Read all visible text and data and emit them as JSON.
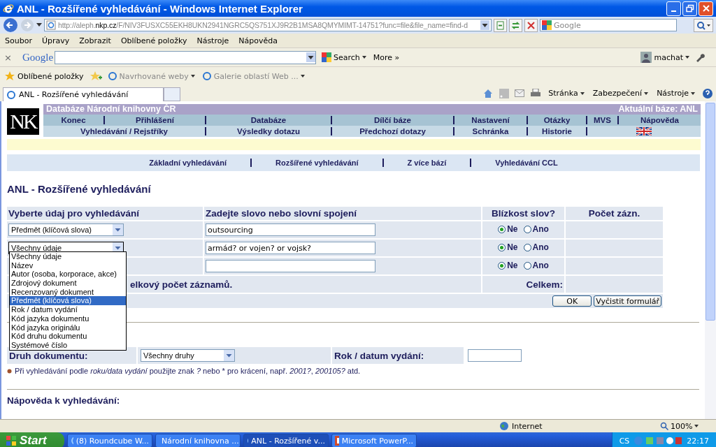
{
  "window": {
    "title": "ANL - Rozšířené vyhledávání - Windows Internet Explorer"
  },
  "address_bar": {
    "url_start": "http://aleph.",
    "url_domain": "nkp.cz",
    "url_end": "/F/NIV3FUSXC55EKH8UKN2941NGRC5QS751XJ9R2B1MSA8QMYMIMT-14751?func=file&file_name=find-d"
  },
  "search_box": {
    "placeholder": "Google"
  },
  "menu": [
    "Soubor",
    "Úpravy",
    "Zobrazit",
    "Oblíbené položky",
    "Nástroje",
    "Nápověda"
  ],
  "google_toolbar": {
    "close": "×",
    "logo": "Google",
    "search": "Search",
    "more": "More »",
    "user": "machat"
  },
  "favorites": {
    "label": "Oblíbené položky",
    "items": [
      "Navrhované weby",
      "Galerie oblastí Web ..."
    ]
  },
  "tabs": [
    {
      "label": "ANL - Rozšířené vyhledávání",
      "selected": true
    }
  ],
  "command_bar": [
    "Stránka",
    "Zabezpečení",
    "Nástroje"
  ],
  "page": {
    "logo": "NK",
    "site_title": "Databáze Národní knihovny ČR",
    "current_base": "Aktuální báze:  ANL",
    "nav_row_1": [
      "Konec",
      "Přihlášení",
      "Databáze",
      "Dílčí báze",
      "Nastavení",
      "Otázky",
      "MVS",
      "Nápověda"
    ],
    "nav_row_2": [
      "Vyhledávání / Rejstříky",
      "Výsledky dotazu",
      "Předchozí dotazy",
      "Schránka",
      "Historie"
    ],
    "subnav": [
      "Základní vyhledávání",
      "Rozšířené vyhledávání",
      "Z více bází",
      "Vyhledávání CCL"
    ],
    "heading": "ANL - Rozšířené vyhledávání",
    "form": {
      "columns": [
        "Vyberte údaj pro vyhledávání",
        "Zadejte slovo nebo slovní spojení",
        "Blízkost slov?",
        "Počet zázn."
      ],
      "rows": [
        {
          "field": "Předmět (klíčová slova)",
          "value": "outsourcing",
          "proximity": [
            {
              "label": "Ne",
              "selected": true
            },
            {
              "label": "Ano",
              "selected": false
            }
          ]
        },
        {
          "field": "Všechny údaje",
          "open": true,
          "value": "armád? or vojen? or vojsk?",
          "proximity": [
            {
              "label": "Ne",
              "selected": true
            },
            {
              "label": "Ano",
              "selected": false
            }
          ]
        },
        {
          "value": "",
          "proximity": [
            {
              "label": "Ne",
              "selected": true
            },
            {
              "label": "Ano",
              "selected": false
            }
          ]
        }
      ],
      "dropdown_options": [
        {
          "label": "Všechny údaje",
          "selected": false
        },
        {
          "label": "Název",
          "selected": false
        },
        {
          "label": "Autor (osoba, korporace, akce)",
          "selected": false
        },
        {
          "label": "Zdrojový dokument",
          "selected": false
        },
        {
          "label": "Recenzovaný dokument",
          "selected": false
        },
        {
          "label": "Předmět (klíčová slova)",
          "selected": true
        },
        {
          "label": "Rok / datum vydání",
          "selected": false
        },
        {
          "label": "Kód jazyka dokumentu",
          "selected": false
        },
        {
          "label": "Kód jazyka originálu",
          "selected": false
        },
        {
          "label": "Kód druhu dokumentu",
          "selected": false
        },
        {
          "label": "Systémové číslo",
          "selected": false
        }
      ],
      "total_text": "elkový počet záznamů.",
      "total_label": "Celkem:",
      "buttons": [
        "OK",
        "Vyčistit formulář"
      ]
    },
    "filters": {
      "doc_type_label": "Druh dokumentu:",
      "doc_type_value": "Všechny druhy",
      "year_label": "Rok / datum vydání:"
    },
    "note": [
      {
        "text": "Při vyhledávání podle ",
        "italic": false
      },
      {
        "text": "roku/data vydání",
        "italic": true
      },
      {
        "text": " použijte znak ",
        "italic": false
      },
      {
        "text": "?",
        "italic": true
      },
      {
        "text": " nebo * pro krácení, např. ",
        "italic": false
      },
      {
        "text": "2001?",
        "italic": true
      },
      {
        "text": ", ",
        "italic": false
      },
      {
        "text": "200105?",
        "italic": true
      },
      {
        "text": " atd.",
        "italic": false
      }
    ],
    "help_heading": "Nápověda k vyhledávání:"
  },
  "status_bar": {
    "zone": "Internet",
    "zoom": "100%"
  },
  "taskbar": {
    "start": "Start",
    "tasks": [
      {
        "label": "(8) Roundcube W...",
        "kind": "ie",
        "selected": false
      },
      {
        "label": "Národní knihovna ...",
        "kind": "ie",
        "selected": false
      },
      {
        "label": "ANL - Rozšířené v...",
        "kind": "ie",
        "selected": true
      },
      {
        "label": "Microsoft PowerP...",
        "kind": "ppt",
        "selected": false
      }
    ],
    "language": "CS",
    "clock": "22:17"
  }
}
